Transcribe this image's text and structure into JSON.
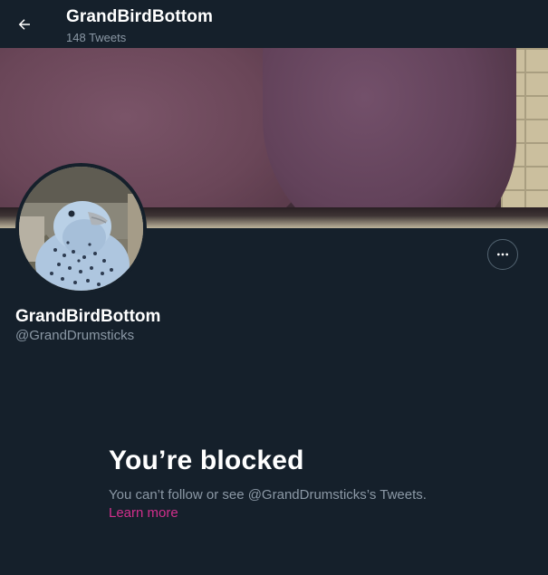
{
  "header": {
    "title": "GrandBirdBottom",
    "tweet_count": "148 Tweets",
    "back_icon": "arrow-left-icon"
  },
  "profile": {
    "display_name": "GrandBirdBottom",
    "handle": "@GrandDrumsticks",
    "more_icon": "ellipsis-icon"
  },
  "blocked": {
    "title": "You’re blocked",
    "message": "You can’t follow or see @GrandDrumsticks’s Tweets.",
    "link_label": "Learn more"
  },
  "colors": {
    "background": "#15202b",
    "secondary_text": "#8b98a5",
    "accent_link": "#d12f8c"
  }
}
